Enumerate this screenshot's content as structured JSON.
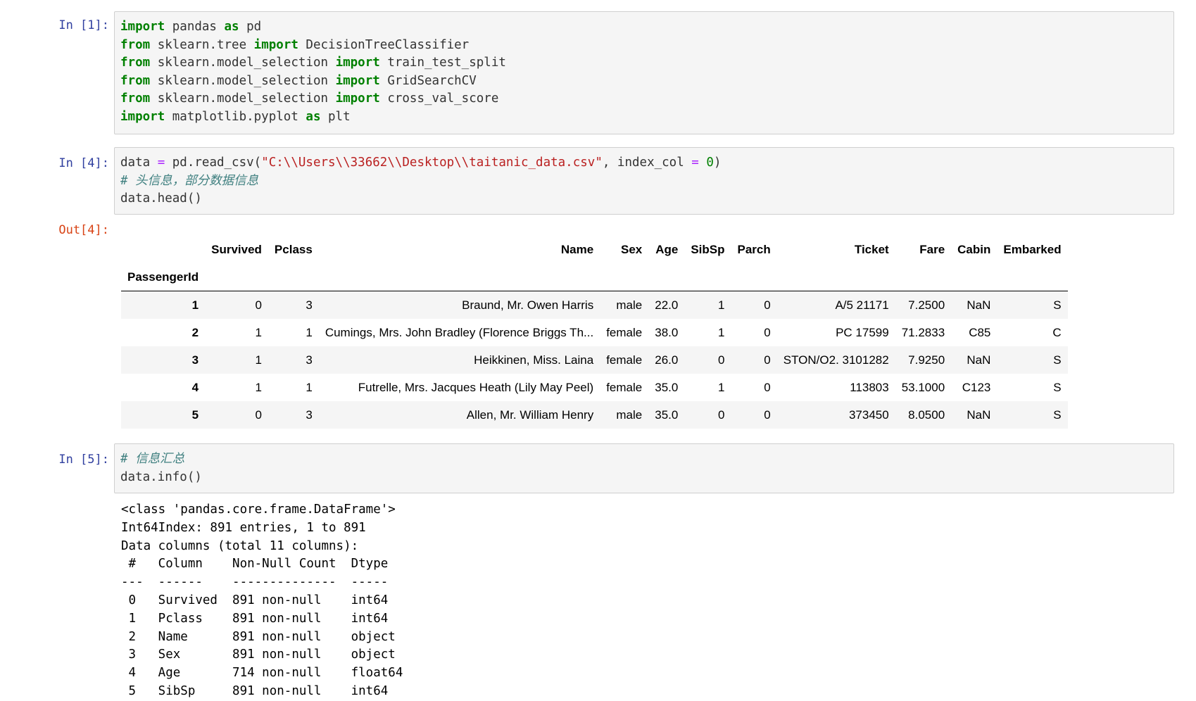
{
  "cells": {
    "c1": {
      "prompt": "In  [1]:",
      "lines": [
        [
          {
            "t": "import",
            "c": "kw"
          },
          {
            "t": " pandas "
          },
          {
            "t": "as",
            "c": "kw"
          },
          {
            "t": " pd"
          }
        ],
        [
          {
            "t": "from",
            "c": "kw"
          },
          {
            "t": " sklearn.tree "
          },
          {
            "t": "import",
            "c": "kw"
          },
          {
            "t": " DecisionTreeClassifier"
          }
        ],
        [
          {
            "t": "from",
            "c": "kw"
          },
          {
            "t": " sklearn.model_selection "
          },
          {
            "t": "import",
            "c": "kw"
          },
          {
            "t": " train_test_split"
          }
        ],
        [
          {
            "t": "from",
            "c": "kw"
          },
          {
            "t": " sklearn.model_selection "
          },
          {
            "t": "import",
            "c": "kw"
          },
          {
            "t": " GridSearchCV"
          }
        ],
        [
          {
            "t": "from",
            "c": "kw"
          },
          {
            "t": " sklearn.model_selection "
          },
          {
            "t": "import",
            "c": "kw"
          },
          {
            "t": " cross_val_score"
          }
        ],
        [
          {
            "t": "import",
            "c": "kw"
          },
          {
            "t": " matplotlib.pyplot "
          },
          {
            "t": "as",
            "c": "kw"
          },
          {
            "t": " plt"
          }
        ]
      ]
    },
    "c4": {
      "prompt": "In  [4]:",
      "out_prompt": "Out[4]:",
      "lines": [
        [
          {
            "t": "data "
          },
          {
            "t": "=",
            "c": "op"
          },
          {
            "t": " pd.read_csv("
          },
          {
            "t": "\"C:\\\\Users\\\\33662\\\\Desktop\\\\taitanic_data.csv\"",
            "c": "str"
          },
          {
            "t": ", index_col "
          },
          {
            "t": "=",
            "c": "op"
          },
          {
            "t": " "
          },
          {
            "t": "0",
            "c": "num"
          },
          {
            "t": ")"
          }
        ],
        [
          {
            "t": "# 头信息，部分数据信息",
            "c": "cm"
          }
        ],
        [
          {
            "t": "data.head()"
          }
        ]
      ]
    },
    "c5": {
      "prompt": "In  [5]:",
      "lines": [
        [
          {
            "t": "# 信息汇总",
            "c": "cm"
          }
        ],
        [
          {
            "t": "data.info()"
          }
        ]
      ]
    }
  },
  "table": {
    "columns": [
      "Survived",
      "Pclass",
      "Name",
      "Sex",
      "Age",
      "SibSp",
      "Parch",
      "Ticket",
      "Fare",
      "Cabin",
      "Embarked"
    ],
    "index_name": "PassengerId",
    "rows": [
      {
        "id": "1",
        "cells": [
          "0",
          "3",
          "Braund, Mr. Owen Harris",
          "male",
          "22.0",
          "1",
          "0",
          "A/5 21171",
          "7.2500",
          "NaN",
          "S"
        ]
      },
      {
        "id": "2",
        "cells": [
          "1",
          "1",
          "Cumings, Mrs. John Bradley (Florence Briggs Th...",
          "female",
          "38.0",
          "1",
          "0",
          "PC 17599",
          "71.2833",
          "C85",
          "C"
        ]
      },
      {
        "id": "3",
        "cells": [
          "1",
          "3",
          "Heikkinen, Miss. Laina",
          "female",
          "26.0",
          "0",
          "0",
          "STON/O2. 3101282",
          "7.9250",
          "NaN",
          "S"
        ]
      },
      {
        "id": "4",
        "cells": [
          "1",
          "1",
          "Futrelle, Mrs. Jacques Heath (Lily May Peel)",
          "female",
          "35.0",
          "1",
          "0",
          "113803",
          "53.1000",
          "C123",
          "S"
        ]
      },
      {
        "id": "5",
        "cells": [
          "0",
          "3",
          "Allen, Mr. William Henry",
          "male",
          "35.0",
          "0",
          "0",
          "373450",
          "8.0500",
          "NaN",
          "S"
        ]
      }
    ]
  },
  "info_output": [
    "<class 'pandas.core.frame.DataFrame'>",
    "Int64Index: 891 entries, 1 to 891",
    "Data columns (total 11 columns):",
    " #   Column    Non-Null Count  Dtype  ",
    "---  ------    --------------  -----  ",
    " 0   Survived  891 non-null    int64  ",
    " 1   Pclass    891 non-null    int64  ",
    " 2   Name      891 non-null    object ",
    " 3   Sex       891 non-null    object ",
    " 4   Age       714 non-null    float64",
    " 5   SibSp     891 non-null    int64  "
  ],
  "colors": {
    "keyword": "#008000",
    "operator": "#AA22FF",
    "string": "#BA2121",
    "comment": "#408080",
    "in_prompt": "#303F9F",
    "out_prompt": "#D84315",
    "cell_bg": "#f5f5f5"
  }
}
